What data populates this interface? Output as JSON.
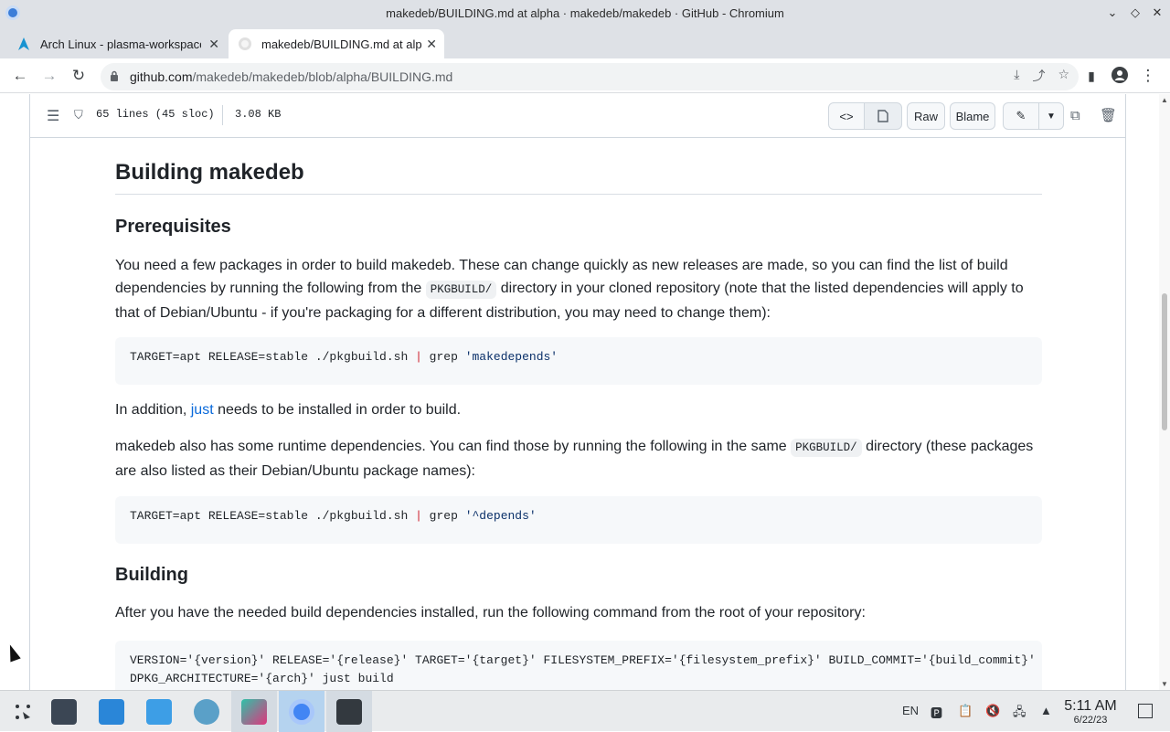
{
  "window": {
    "title": "makedeb/BUILDING.md at alpha · makedeb/makedeb · GitHub - Chromium",
    "minimize": "⌄",
    "maximize": "◇",
    "close": "✕"
  },
  "tabs": [
    {
      "title": "Arch Linux - plasma-workspace",
      "favicon": "arch-linux-icon",
      "active": false
    },
    {
      "title": "makedeb/BUILDING.md at alpha",
      "favicon": "github-icon",
      "active": true
    }
  ],
  "tabstrip": {
    "new_tab": "+",
    "tab_search": "⌄"
  },
  "toolbar": {
    "back": "←",
    "forward": "→",
    "reload": "↻",
    "url_host": "github.com",
    "url_path": "/makedeb/makedeb/blob/alpha/BUILDING.md"
  },
  "file_header": {
    "lines": "65 lines (45 sloc)",
    "size": "3.08 KB",
    "raw": "Raw",
    "blame": "Blame"
  },
  "doc": {
    "h1": "Building makedeb",
    "h2_prereq": "Prerequisites",
    "p1_a": "You need a few packages in order to build makedeb. These can change quickly as new releases are made, so you can find the list of build dependencies by running the following from the ",
    "p1_code": "PKGBUILD/",
    "p1_b": " directory in your cloned repository (note that the listed dependencies will apply to that of Debian/Ubuntu - if you're packaging for a different distribution, you may need to change them):",
    "code1_a": "TARGET=apt RELEASE=stable ./pkgbuild.sh ",
    "code1_pipe": "|",
    "code1_b": " grep ",
    "code1_str": "'makedepends'",
    "p2_a": "In addition, ",
    "p2_link": "just",
    "p2_b": " needs to be installed in order to build.",
    "p3_a": "makedeb also has some runtime dependencies. You can find those by running the following in the same ",
    "p3_code": "PKGBUILD/",
    "p3_b": " directory (these packages are also listed as their Debian/Ubuntu package names):",
    "code2_a": "TARGET=apt RELEASE=stable ./pkgbuild.sh ",
    "code2_pipe": "|",
    "code2_b": " grep ",
    "code2_str": "'^depends'",
    "h2_building": "Building",
    "p4": "After you have the needed build dependencies installed, run the following command from the root of your repository:",
    "code3_line1": "VERSION='{version}' RELEASE='{release}' TARGET='{target}' FILESYSTEM_PREFIX='{filesystem_prefix}' BUILD_COMMIT='{build_commit}' \\",
    "code3_line2": "DPKG_ARCHITECTURE='{arch}' just build"
  },
  "taskbar": {
    "items": [
      "application-launcher-icon",
      "system-settings-icon",
      "discover-store-icon",
      "file-manager-icon",
      "web-browser-icon",
      "kate-editor-icon",
      "chromium-icon",
      "konsole-icon"
    ],
    "lang": "EN",
    "time": "5:11 AM",
    "date": "6/22/23"
  },
  "colors": {
    "link": "#0969da",
    "taskbar_active": "#b5d3ef",
    "code_bg": "#f6f8fa"
  }
}
